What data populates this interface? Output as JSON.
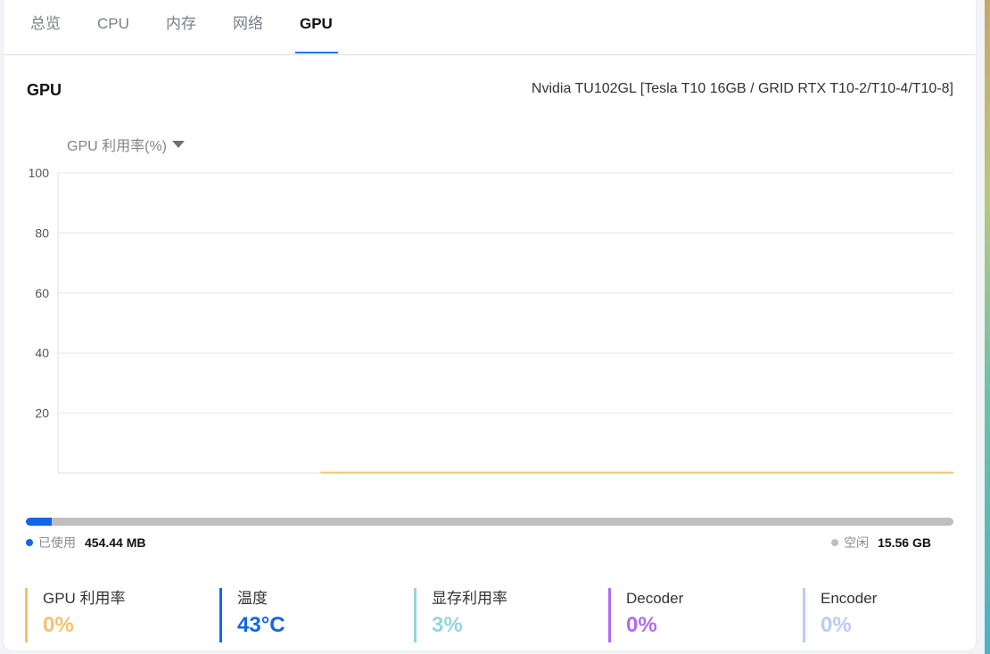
{
  "tabs": [
    {
      "label": "总览",
      "active": false
    },
    {
      "label": "CPU",
      "active": false
    },
    {
      "label": "内存",
      "active": false
    },
    {
      "label": "网络",
      "active": false
    },
    {
      "label": "GPU",
      "active": true
    }
  ],
  "gpu": {
    "title": "GPU",
    "model": "Nvidia TU102GL [Tesla T10 16GB / GRID RTX T10-2/T10-4/T10-8]"
  },
  "metric_selector": {
    "label": "GPU 利用率(%)",
    "icon": "caret-down-icon"
  },
  "chart_data": {
    "type": "line",
    "title": "",
    "xlabel": "",
    "ylabel": "",
    "ylim": [
      0,
      100
    ],
    "yticks": [
      20,
      40,
      60,
      80,
      100
    ],
    "grid": true,
    "series": [
      {
        "color": "#f3c46d",
        "values": [
          0,
          0,
          0,
          0,
          0,
          0,
          0,
          0,
          0,
          0,
          0,
          0,
          0,
          0,
          0,
          0,
          0,
          0,
          0,
          0,
          0,
          0,
          0,
          0,
          0,
          0,
          0,
          0,
          0,
          0,
          0,
          0
        ],
        "x_start_fraction": 0.293
      }
    ]
  },
  "memory": {
    "used_fraction": 0.028,
    "used_label": "已使用",
    "used_value": "454.44 MB",
    "free_label": "空闲",
    "free_value": "15.56 GB",
    "used_color": "#1565e6",
    "free_color": "#bfbfbf"
  },
  "stats": [
    {
      "label": "GPU 利用率",
      "value": "0%",
      "color": "#f5c16c"
    },
    {
      "label": "温度",
      "value": "43°C",
      "color": "#1565e6"
    },
    {
      "label": "显存利用率",
      "value": "3%",
      "color": "#93d5e0"
    },
    {
      "label": "Decoder",
      "value": "0%",
      "color": "#b06cf0"
    },
    {
      "label": "Encoder",
      "value": "0%",
      "color": "#bccbf5"
    }
  ]
}
